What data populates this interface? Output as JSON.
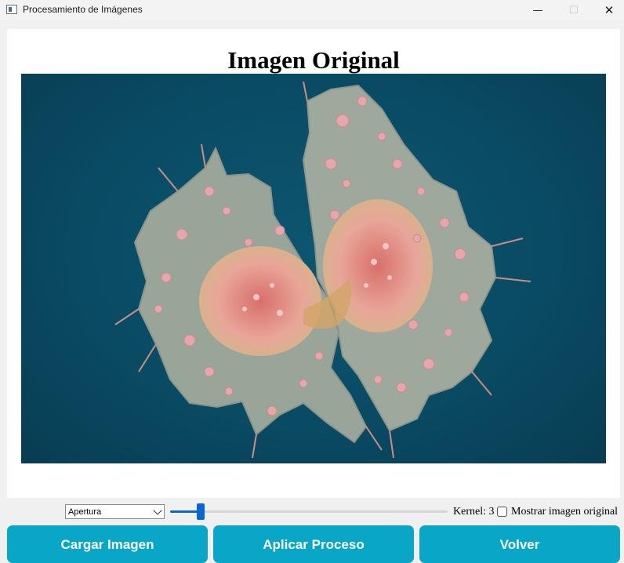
{
  "window": {
    "title": "Procesamiento de Imágenes",
    "minimize_glyph": "—",
    "maximize_glyph": "☐",
    "close_glyph": "✕"
  },
  "panel": {
    "title": "Imagen Original"
  },
  "controls": {
    "operation_select": {
      "value": "Apertura"
    },
    "kernel_slider": {
      "fraction": 0.11
    },
    "kernel_label": "Kernel: 3",
    "show_original_checkbox": {
      "label": "Mostrar imagen original",
      "checked": false
    }
  },
  "buttons": {
    "load": "Cargar Imagen",
    "apply": "Aplicar Proceso",
    "back": "Volver"
  },
  "colors": {
    "button_bg": "#0aa6c8",
    "slider_accent": "#0a66d0",
    "image_bg": "#0a4b64"
  }
}
